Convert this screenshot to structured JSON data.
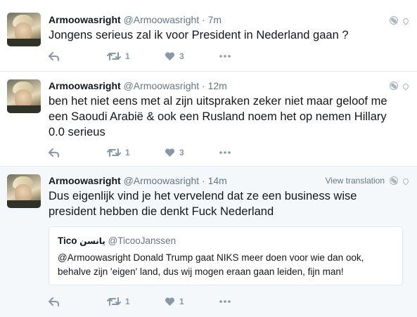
{
  "tweets": [
    {
      "name": "Armoowasright",
      "handle": "@Armoowasright",
      "time": "· 7m",
      "text": "Jongens serieus zal ik voor President in Nederland gaan ?",
      "retweets": "1",
      "likes": "3"
    },
    {
      "name": "Armoowasright",
      "handle": "@Armoowasright",
      "time": "· 12m",
      "text": "ben het niet eens met al zijn uitspraken zeker niet maar geloof me een Saoudi Arabië & ook een Rusland noem het op nemen Hillary 0.0 serieus",
      "retweets": "1",
      "likes": "3"
    },
    {
      "name": "Armoowasright",
      "handle": "@Armoowasright",
      "time": "· 14m",
      "view_translation": "View translation",
      "text": "Dus eigenlijk vind je het vervelend dat ze een business wise president hebben die denkt Fuck Nederland",
      "retweets": "1",
      "likes": "1",
      "quote": {
        "name": "Tico",
        "name_arabic": "يانسن",
        "handle": "@TicooJanssen",
        "text": "@Armoowasright Donald Trump gaat NIKS meer doen voor wie dan ook, behalve zijn 'eigen' land, dus wij mogen eraan gaan leiden, fijn man!"
      }
    }
  ],
  "icons": {
    "reply": "reply-icon",
    "retweet": "retweet-icon",
    "like": "heart-icon",
    "more": "more-icon",
    "globe": "globe-icon",
    "location": "location-pin-icon"
  },
  "colors": {
    "name": "#14171a",
    "meta": "#657786",
    "icon": "#8899a6",
    "highlight_bg": "#f5f8fa",
    "border": "#e6ecf0"
  }
}
